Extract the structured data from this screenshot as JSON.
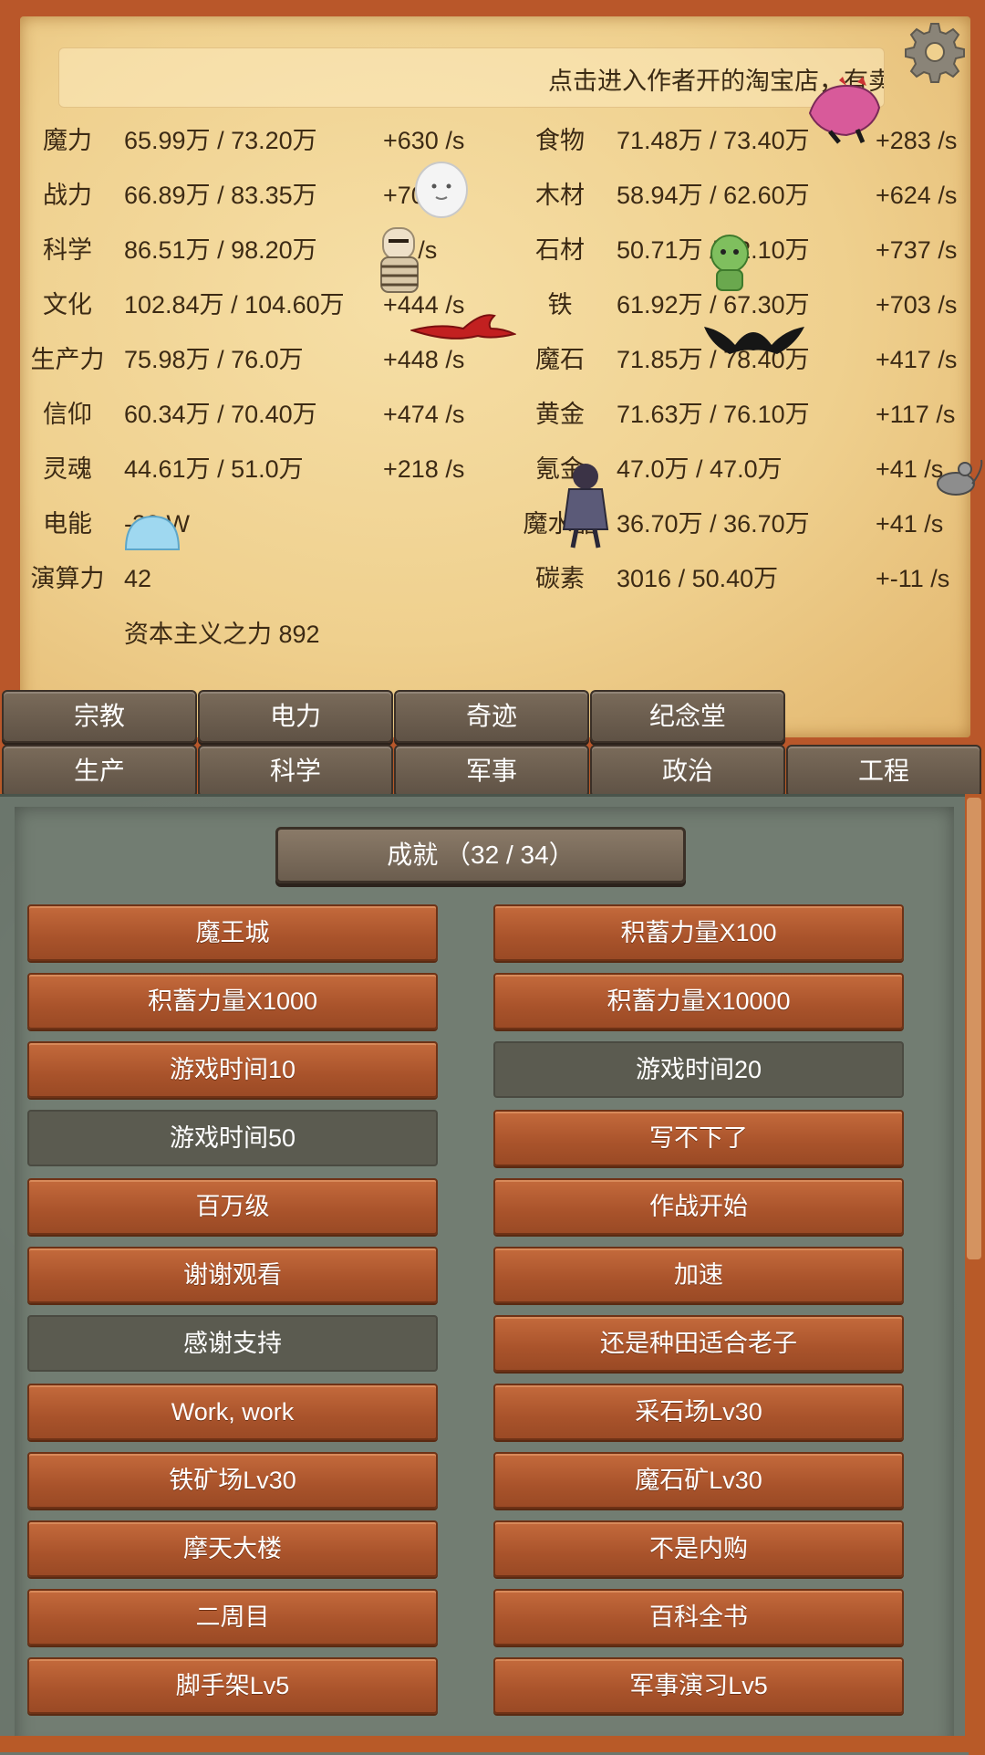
{
  "marquee": {
    "text": "点击进入作者开的淘宝店，有卖"
  },
  "resources_left": [
    {
      "name": "魔力",
      "amount": "65.99万 / 73.20万",
      "rate": "+630 /s"
    },
    {
      "name": "战力",
      "amount": "66.89万 / 83.35万",
      "rate": "+708 /s"
    },
    {
      "name": "科学",
      "amount": "86.51万 / 98.20万",
      "rate": "+7 /s"
    },
    {
      "name": "文化",
      "amount": "102.84万 / 104.60万",
      "rate": "+444 /s"
    },
    {
      "name": "生产力",
      "amount": "75.98万 / 76.0万",
      "rate": "+448 /s"
    },
    {
      "name": "信仰",
      "amount": "60.34万 / 70.40万",
      "rate": "+474 /s"
    },
    {
      "name": "灵魂",
      "amount": "44.61万 / 51.0万",
      "rate": "+218 /s"
    },
    {
      "name": "电能",
      "amount": "-28 W",
      "rate": ""
    },
    {
      "name": "演算力",
      "amount": "42",
      "rate": ""
    }
  ],
  "resources_right": [
    {
      "name": "食物",
      "amount": "71.48万 / 73.40万",
      "rate": "+283 /s"
    },
    {
      "name": "木材",
      "amount": "58.94万 / 62.60万",
      "rate": "+624 /s"
    },
    {
      "name": "石材",
      "amount": "50.71万 / 62.10万",
      "rate": "+737 /s"
    },
    {
      "name": "铁",
      "amount": "61.92万 / 67.30万",
      "rate": "+703 /s"
    },
    {
      "name": "魔石",
      "amount": "71.85万 / 78.40万",
      "rate": "+417 /s"
    },
    {
      "name": "黄金",
      "amount": "71.63万 / 76.10万",
      "rate": "+117 /s"
    },
    {
      "name": "氪金",
      "amount": "47.0万 / 47.0万",
      "rate": "+41 /s"
    },
    {
      "name": "魔水晶",
      "amount": "36.70万 / 36.70万",
      "rate": "+41 /s"
    },
    {
      "name": "碳素",
      "amount": "3016 / 50.40万",
      "rate": "+-11 /s"
    }
  ],
  "capitalism": "资本主义之力 892",
  "tabs_row1": [
    "宗教",
    "电力",
    "奇迹",
    "纪念堂"
  ],
  "tabs_row2": [
    "生产",
    "科学",
    "军事",
    "政治",
    "工程"
  ],
  "achievements_title": "成就 （32 / 34）",
  "achievements": [
    {
      "label": "魔王城",
      "unlocked": true
    },
    {
      "label": "积蓄力量X100",
      "unlocked": true
    },
    {
      "label": "积蓄力量X1000",
      "unlocked": true
    },
    {
      "label": "积蓄力量X10000",
      "unlocked": true
    },
    {
      "label": "游戏时间10",
      "unlocked": true
    },
    {
      "label": "游戏时间20",
      "unlocked": false
    },
    {
      "label": "游戏时间50",
      "unlocked": false
    },
    {
      "label": "写不下了",
      "unlocked": true
    },
    {
      "label": "百万级",
      "unlocked": true
    },
    {
      "label": "作战开始",
      "unlocked": true
    },
    {
      "label": "谢谢观看",
      "unlocked": true
    },
    {
      "label": "加速",
      "unlocked": true
    },
    {
      "label": "感谢支持",
      "unlocked": false
    },
    {
      "label": "还是种田适合老子",
      "unlocked": true
    },
    {
      "label": "Work, work",
      "unlocked": true
    },
    {
      "label": "采石场Lv30",
      "unlocked": true
    },
    {
      "label": "铁矿场Lv30",
      "unlocked": true
    },
    {
      "label": "魔石矿Lv30",
      "unlocked": true
    },
    {
      "label": "摩天大楼",
      "unlocked": true
    },
    {
      "label": "不是内购",
      "unlocked": true
    },
    {
      "label": "二周目",
      "unlocked": true
    },
    {
      "label": "百科全书",
      "unlocked": true
    },
    {
      "label": "脚手架Lv5",
      "unlocked": true
    },
    {
      "label": "军事演习Lv5",
      "unlocked": true
    }
  ],
  "colors": {
    "frame": "#b85a28",
    "parchment": "#efd08e",
    "tab": "#6d5f50",
    "achievement_on": "#b25c30",
    "achievement_off": "#5b5b50",
    "stone": "#6b766c"
  },
  "icons": [
    "gear-icon",
    "ghost-sprite",
    "mummy-sprite",
    "red-dragon-sprite",
    "slime-sprite",
    "green-goblin-sprite",
    "bat-sprite",
    "pink-demon-beast-sprite",
    "witch-knight-sprite",
    "rat-sprite"
  ]
}
